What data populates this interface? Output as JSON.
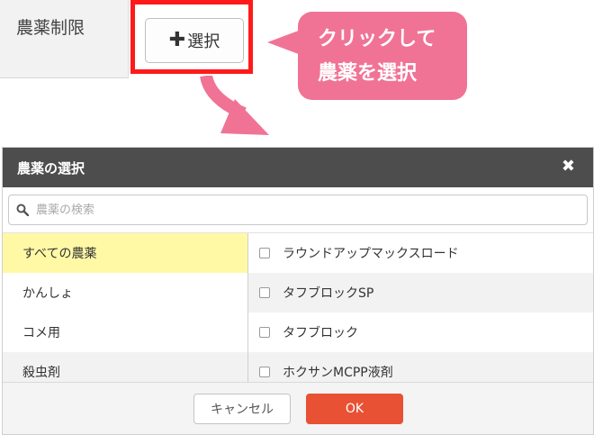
{
  "restriction": {
    "label": "農薬制限",
    "select_button_label": "選択",
    "select_button_icon": "plus-icon"
  },
  "callout": {
    "line1": "クリックして",
    "line2": "農薬を選択",
    "color": "#f07396"
  },
  "highlight_color": "#ff1a1a",
  "modal": {
    "title": "農薬の選択",
    "close_icon": "close-icon",
    "search": {
      "placeholder": "農薬の検索",
      "value": ""
    },
    "categories": [
      {
        "label": "すべての農薬",
        "selected": true
      },
      {
        "label": "かんしょ",
        "selected": false
      },
      {
        "label": "コメ用",
        "selected": false
      },
      {
        "label": "殺虫剤",
        "selected": false
      }
    ],
    "pesticides": [
      {
        "label": "ラウンドアップマックスロード",
        "checked": false
      },
      {
        "label": "タフブロックSP",
        "checked": false
      },
      {
        "label": "タフブロック",
        "checked": false
      },
      {
        "label": "ホクサンMCPP液剤",
        "checked": false
      }
    ],
    "cancel_label": "キャンセル",
    "ok_label": "OK",
    "ok_color": "#e85134",
    "header_color": "#4d4d4d"
  }
}
